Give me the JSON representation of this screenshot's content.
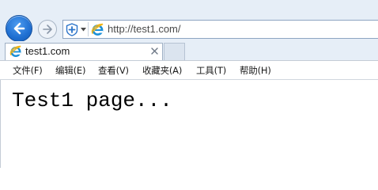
{
  "browser": {
    "address_url": "http://test1.com/",
    "tab_title": "test1.com",
    "icons": {
      "back": "back-arrow-icon",
      "forward": "forward-arrow-icon",
      "compat": "compatibility-view-icon",
      "site": "ie-logo-icon",
      "close": "close-icon"
    },
    "colors": {
      "back_button": "#1f6fd1",
      "chrome_background": "#e6eef7",
      "ie_logo": "#1a8fd8"
    }
  },
  "menu": {
    "items": [
      {
        "label": "文件(F)"
      },
      {
        "label": "编辑(E)"
      },
      {
        "label": "查看(V)"
      },
      {
        "label": "收藏夹(A)"
      },
      {
        "label": "工具(T)"
      },
      {
        "label": "帮助(H)"
      }
    ]
  },
  "page": {
    "body_text": "Test1 page..."
  }
}
